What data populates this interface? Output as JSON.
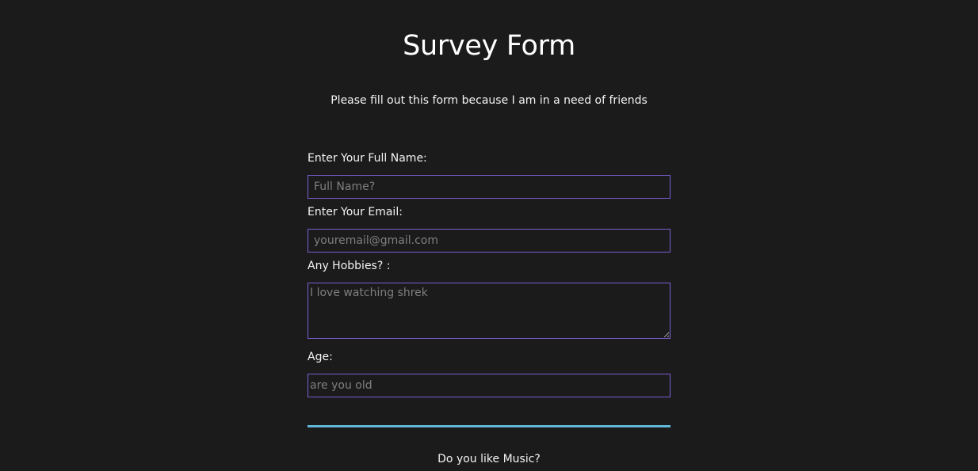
{
  "header": {
    "title": "Survey Form",
    "description": "Please fill out this form because I am in a need of friends"
  },
  "form": {
    "name": {
      "label": "Enter Your Full Name:",
      "placeholder": "Full Name?",
      "value": ""
    },
    "email": {
      "label": "Enter Your Email:",
      "placeholder": "youremail@gmail.com",
      "value": ""
    },
    "hobbies": {
      "label": "Any Hobbies? :",
      "placeholder": "I love watching shrek",
      "value": ""
    },
    "age": {
      "label": "Age:",
      "placeholder": "are you old",
      "value": ""
    },
    "music_question": "Do you like Music?"
  },
  "colors": {
    "background": "#1b1b1c",
    "field_border": "#7b5ecf",
    "divider": "#62b6d8",
    "text": "#f4f4f4",
    "placeholder": "#7f7f7f"
  }
}
